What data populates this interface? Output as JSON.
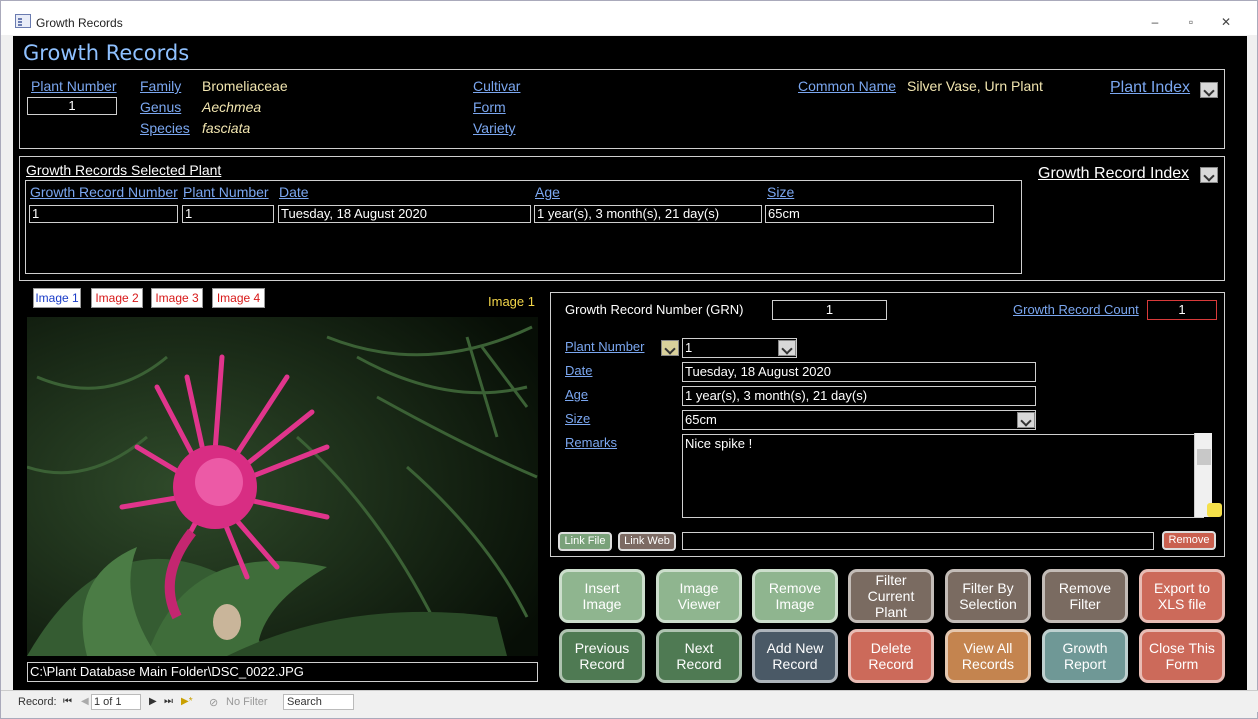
{
  "window": {
    "title": "Growth Records",
    "minimize": "–",
    "maximize": "▫",
    "close": "✕"
  },
  "header": {
    "title": "Growth Records"
  },
  "plant": {
    "plant_number_label": "Plant Number",
    "plant_number": "1",
    "family_label": "Family",
    "family": "Bromeliaceae",
    "genus_label": "Genus",
    "genus": "Aechmea",
    "species_label": "Species",
    "species": "fasciata",
    "cultivar_label": "Cultivar",
    "form_label": "Form",
    "variety_label": "Variety",
    "common_name_label": "Common Name",
    "common_name": "Silver Vase, Urn Plant",
    "plant_index": "Plant Index"
  },
  "selected": {
    "title": "Growth Records Selected Plant",
    "growth_record_index": "Growth Record Index",
    "columns": [
      "Growth Record Number",
      "Plant Number",
      "Date",
      "Age",
      "Size"
    ],
    "row": {
      "grn": "1",
      "plant_number": "1",
      "date": "Tuesday, 18 August 2020",
      "age": "1 year(s), 3 month(s), 21 day(s)",
      "size": "65cm"
    }
  },
  "images": {
    "tabs": [
      "Image 1",
      "Image 2",
      "Image 3",
      "Image 4"
    ],
    "current": "Image 1",
    "path": "C:\\Plant Database Main Folder\\DSC_0022.JPG"
  },
  "detail": {
    "grn_label": "Growth Record Number (GRN)",
    "grn": "1",
    "count_label": "Growth Record Count",
    "count": "1",
    "plant_number_label": "Plant Number",
    "plant_number": "1",
    "date_label": "Date",
    "date": "Tuesday, 18 August 2020",
    "age_label": "Age",
    "age": "1 year(s), 3 month(s), 21 day(s)",
    "size_label": "Size",
    "size": "65cm",
    "remarks_label": "Remarks",
    "remarks": "Nice spike !",
    "link_file": "Link File",
    "link_web": "Link Web",
    "link_value": "",
    "remove": "Remove"
  },
  "buttons": {
    "insert_image": "Insert Image",
    "image_viewer": "Image Viewer",
    "remove_image": "Remove Image",
    "filter_current": "Filter Current Plant",
    "filter_selection": "Filter By Selection",
    "remove_filter": "Remove Filter",
    "export_xls": "Export to XLS file",
    "previous": "Previous Record",
    "next": "Next Record",
    "add_new": "Add New Record",
    "delete": "Delete Record",
    "view_all": "View All Records",
    "growth_report": "Growth Report",
    "close_form": "Close This Form"
  },
  "navigation": {
    "record_label": "Record:",
    "position": "1 of 1",
    "filter": "No Filter",
    "search": "Search"
  },
  "colors": {
    "form_bg": "#000000",
    "link": "#7ba7f0",
    "value": "#f2e6b0",
    "green_btn": "#8fb58f",
    "dark_green_btn": "#4f7a53",
    "tan_btn": "#7a6b61",
    "red_btn": "#cc6a5a",
    "orange_btn": "#c4844f",
    "teal_btn": "#6f9896",
    "slate_btn": "#4a5966"
  }
}
